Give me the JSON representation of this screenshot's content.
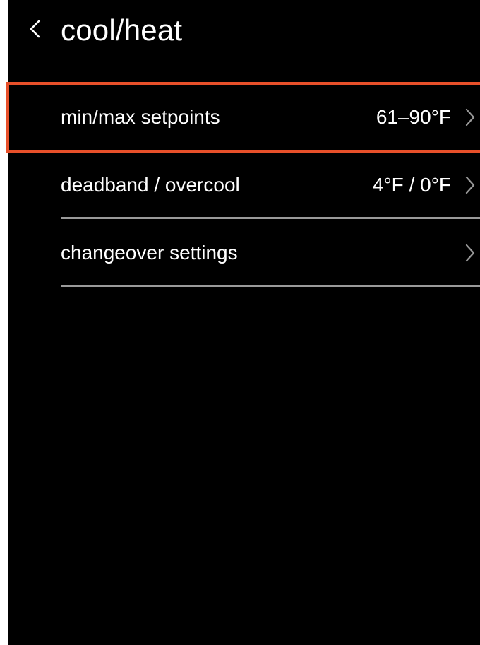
{
  "header": {
    "back_icon": "chevron-left-icon",
    "title": "cool/heat"
  },
  "menu": {
    "items": [
      {
        "label": "min/max setpoints",
        "value": "61–90°F",
        "chevron_icon": "chevron-right-icon",
        "highlighted": true
      },
      {
        "label": "deadband / overcool",
        "value": "4°F / 0°F",
        "chevron_icon": "chevron-right-icon",
        "highlighted": false
      },
      {
        "label": "changeover settings",
        "value": "",
        "chevron_icon": "chevron-right-icon",
        "highlighted": false
      }
    ]
  },
  "colors": {
    "background": "#000000",
    "text": "#ffffff",
    "highlight": "#e8502a",
    "divider": "#9a9a9a"
  }
}
